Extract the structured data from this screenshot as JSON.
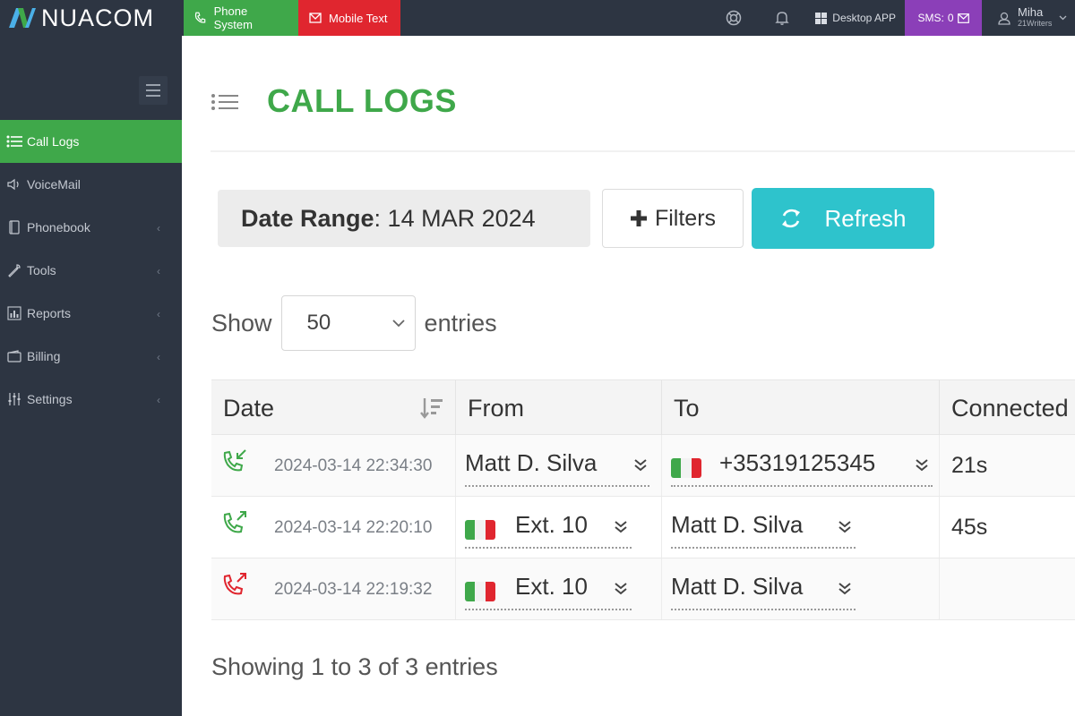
{
  "brand": {
    "name": "NUACOM"
  },
  "topbar": {
    "phone_tab": "Phone System",
    "mobile_tab": "Mobile Text",
    "desktop_app": "Desktop APP",
    "sms_label": "SMS:",
    "sms_count": "0",
    "user_name": "Miha",
    "user_org": "21Writers"
  },
  "sidebar": {
    "items": [
      {
        "label": "Call Logs",
        "icon": "list-icon",
        "active": true
      },
      {
        "label": "VoiceMail",
        "icon": "voicemail-icon"
      },
      {
        "label": "Phonebook",
        "icon": "phonebook-icon"
      },
      {
        "label": "Tools",
        "icon": "wrench-icon"
      },
      {
        "label": "Reports",
        "icon": "bar-chart-icon"
      },
      {
        "label": "Billing",
        "icon": "wallet-icon"
      },
      {
        "label": "Settings",
        "icon": "sliders-icon"
      }
    ]
  },
  "page": {
    "title": "CALL LOGS",
    "date_range_label": "Date Range",
    "date_range_value": ": 14 MAR 2024",
    "filters_label": "Filters",
    "refresh_label": "Refresh",
    "show_label": "Show",
    "entries_value": "50",
    "entries_label": "entries",
    "footer": "Showing 1 to 3 of 3 entries"
  },
  "table": {
    "headers": [
      "Date",
      "From",
      "To",
      "Connected"
    ],
    "rows": [
      {
        "direction": "incoming",
        "status": "answered",
        "date": "2024-03-14 22:34:30",
        "from": "Matt D. Silva",
        "from_flag": false,
        "to": "+35319125345",
        "to_flag": true,
        "connected": "21s"
      },
      {
        "direction": "outgoing",
        "status": "answered",
        "date": "2024-03-14 22:20:10",
        "from": "Ext. 10",
        "from_flag": true,
        "to": "Matt D. Silva",
        "to_flag": false,
        "connected": "45s"
      },
      {
        "direction": "outgoing",
        "status": "missed",
        "date": "2024-03-14 22:19:32",
        "from": "Ext. 10",
        "from_flag": true,
        "to": "Matt D. Silva",
        "to_flag": false,
        "connected": ""
      }
    ]
  },
  "colors": {
    "accent_green": "#3fa84a",
    "alert_red": "#e0262f",
    "refresh_teal": "#2ec3cc",
    "sms_purple": "#8b3fb8",
    "navbar": "#2d3542"
  }
}
